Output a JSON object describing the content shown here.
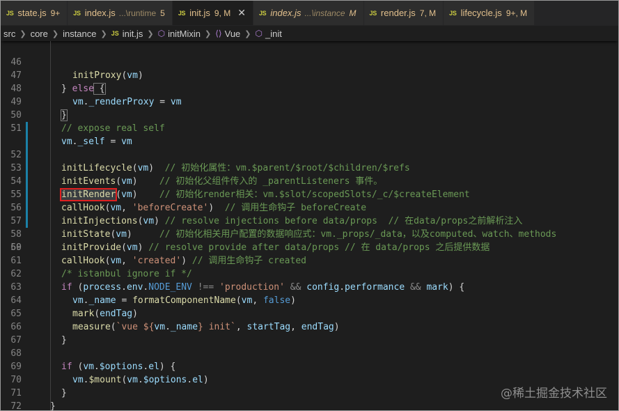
{
  "tabs": [
    {
      "name": "state.js",
      "dir": "",
      "badge": "9+",
      "active": false,
      "italic": false
    },
    {
      "name": "index.js",
      "dir": "...\\runtime",
      "badge": "5",
      "active": false,
      "italic": false
    },
    {
      "name": "init.js",
      "dir": "",
      "badge": "9, M",
      "active": true,
      "italic": false,
      "close": "✕"
    },
    {
      "name": "index.js",
      "dir": "...\\instance",
      "badge": "M",
      "active": false,
      "italic": true
    },
    {
      "name": "render.js",
      "dir": "",
      "badge": "7, M",
      "active": false,
      "italic": false
    },
    {
      "name": "lifecycle.js",
      "dir": "",
      "badge": "9+, M",
      "active": false,
      "italic": false
    }
  ],
  "js_label": "JS",
  "breadcrumb": [
    "src",
    "core",
    "instance",
    "init.js",
    "initMixin",
    "Vue",
    "_init"
  ],
  "line_numbers": [
    "46",
    "47",
    "48",
    "49",
    "50",
    "51",
    "52",
    "53",
    "54",
    "55",
    "56",
    "57",
    "58",
    "59",
    "60",
    "61",
    "62",
    "63",
    "64",
    "65",
    "66",
    "67",
    "68",
    "69",
    "70",
    "71",
    "72",
    "73"
  ],
  "code": {
    "l46": [
      "initProxy",
      "(",
      "vm",
      ")"
    ],
    "l47": [
      "} ",
      "else",
      " {"
    ],
    "l48": [
      "vm",
      ".",
      "_renderProxy",
      " = ",
      "vm"
    ],
    "l49": [
      "}"
    ],
    "l50": [
      "// expose real self"
    ],
    "l51": [
      "vm",
      ".",
      "_self",
      " = ",
      "vm"
    ],
    "l52": [
      "initLifecycle",
      "(",
      "vm",
      ")",
      "  // 初始化属性：vm.$parent/$root/$children/$refs"
    ],
    "l53": [
      "initEvents",
      "(",
      "vm",
      ")",
      "    // 初始化父组件传入的 _parentListeners 事件。"
    ],
    "l54": [
      "initRender",
      "(",
      "vm",
      ")",
      "    // 初始化render相关：vm.$slot/scopedSlots/_c/$createElement"
    ],
    "l55": [
      "callHook",
      "(",
      "vm",
      ", ",
      "'beforeCreate'",
      ")",
      "  // 调用生命钩子 beforeCreate"
    ],
    "l56": [
      "initInjections",
      "(",
      "vm",
      ")",
      " // resolve injections before data/props  // 在data/props之前解析注入"
    ],
    "l57": [
      "initState",
      "(",
      "vm",
      ")",
      "     // 初始化相关用户配置的数据响应式：vm._props/_data，以及computed、watch、methods"
    ],
    "l58": [
      "initProvide",
      "(",
      "vm",
      ")",
      " // resolve provide after data/props // 在 data/props 之后提供数据"
    ],
    "l59": [
      "callHook",
      "(",
      "vm",
      ", ",
      "'created'",
      ")",
      " // 调用生命钩子 created"
    ],
    "l61": [
      "/* istanbul ignore if */"
    ],
    "l62": [
      "if",
      " (",
      "process",
      ".",
      "env",
      ".",
      "NODE_ENV",
      " !== ",
      "'production'",
      " && ",
      "config",
      ".",
      "performance",
      " && ",
      "mark",
      ") {"
    ],
    "l63": [
      "vm",
      ".",
      "_name",
      " = ",
      "formatComponentName",
      "(",
      "vm",
      ", ",
      "false",
      ")"
    ],
    "l64": [
      "mark",
      "(",
      "endTag",
      ")"
    ],
    "l65": [
      "measure",
      "(",
      "`vue ${",
      "vm",
      ".",
      "_name",
      "} init`",
      ", ",
      "startTag",
      ", ",
      "endTag",
      ")"
    ],
    "l66": [
      "}"
    ],
    "l68": [
      "if",
      " (",
      "vm",
      ".",
      "$options",
      ".",
      "el",
      ") {"
    ],
    "l69": [
      "vm",
      ".",
      "$mount",
      "(",
      "vm",
      ".",
      "$options",
      ".",
      "el",
      ")"
    ],
    "l70": [
      "}"
    ],
    "l71": [
      "}"
    ],
    "l72": [
      "}"
    ]
  },
  "watermark": "@稀土掘金技术社区",
  "colors": {
    "background": "#1e1e1e",
    "function": "#dcdcaa",
    "variable": "#9cdcfe",
    "keyword": "#c586c0",
    "boolean": "#569cd6",
    "string": "#ce9178",
    "comment": "#6a9955",
    "modified_gutter": "#1b81a8",
    "highlight_box": "#e02020"
  }
}
